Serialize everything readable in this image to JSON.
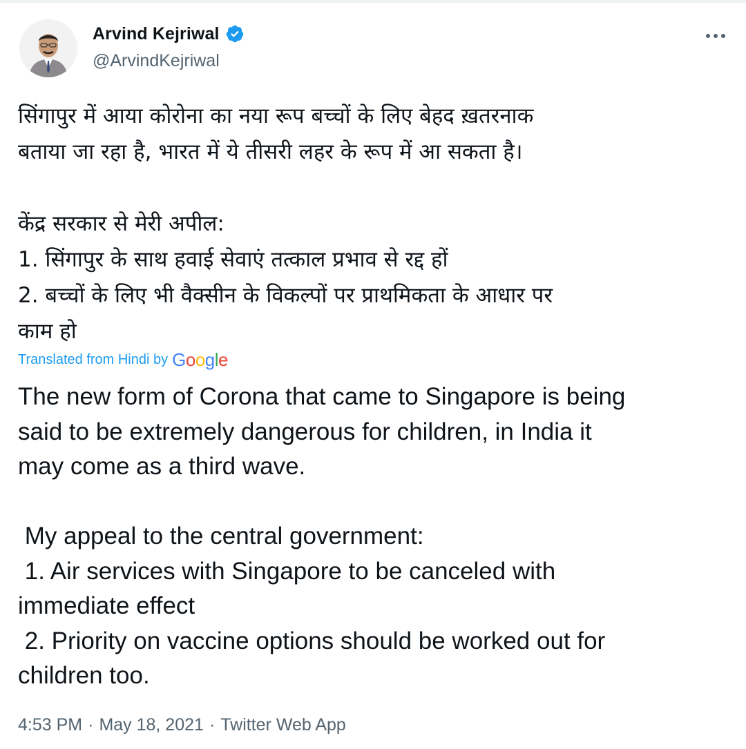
{
  "author": {
    "display_name": "Arvind Kejriwal",
    "handle": "@ArvindKejriwal",
    "verified": true
  },
  "tweet": {
    "text_hindi": "सिंगापुर में आया कोरोना का नया रूप बच्चों के लिए बेहद ख़तरनाक\nबताया जा रहा है, भारत में ये तीसरी लहर के रूप में आ सकता है।\n\nकेंद्र सरकार से मेरी अपील:\n1. सिंगापुर के साथ हवाई सेवाएं तत्काल प्रभाव से रद्द हों\n2. बच्चों के लिए भी वैक्सीन के विकल्पों पर प्राथमिकता के आधार पर\nकाम हो",
    "translation_label": "Translated from Hindi by",
    "translation_provider": "Google",
    "text_english": "The new form of Corona that came to Singapore is being\nsaid to be extremely dangerous for children, in India it\nmay come as a third wave.\n\n My appeal to the central government:\n 1. Air services with Singapore to be canceled with\nimmediate effect\n 2. Priority on vaccine options should be worked out for\nchildren too."
  },
  "meta": {
    "time": "4:53 PM",
    "separator": "·",
    "date": "May 18, 2021",
    "source": "Twitter Web App"
  },
  "icons": {
    "verified": "verified-badge-icon",
    "more": "more-options-icon"
  },
  "colors": {
    "accent": "#1d9bf0",
    "text": "#0f1419",
    "secondary": "#536471"
  }
}
